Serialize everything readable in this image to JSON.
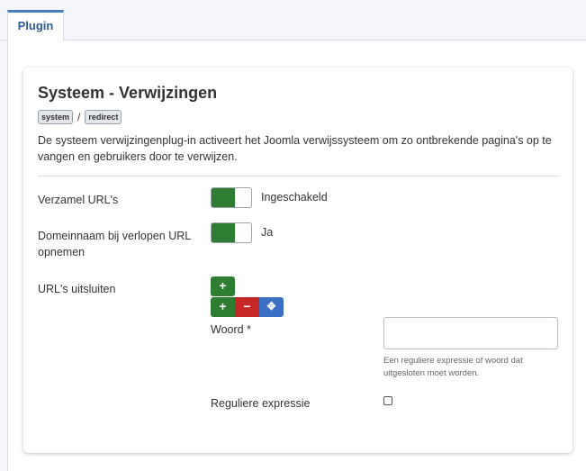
{
  "tabs": [
    {
      "label": "Plugin"
    }
  ],
  "plugin": {
    "title": "Systeem - Verwijzingen",
    "badges": [
      "system",
      "redirect"
    ],
    "badge_separator": "/",
    "description": "De systeem verwijzingenplug-in activeert het Joomla verwijssysteem om zo ontbrekende pagina's op te vangen en gebruikers door te verwijzen."
  },
  "fields": {
    "collect_urls": {
      "label": "Verzamel URL's",
      "state": "Ingeschakeld",
      "on": true
    },
    "domain_name": {
      "label": "Domeinnaam bij verlopen URL opnemen",
      "state": "Ja",
      "on": true
    },
    "exclude_urls": {
      "label": "URL's uitsluiten",
      "buttons": {
        "add": "+",
        "remove": "−",
        "move": "✥"
      },
      "word": {
        "label": "Woord *",
        "value": "",
        "hint": "Een reguliere expressie of woord dat uitgesloten moet worden."
      },
      "regex": {
        "label": "Reguliere expressie",
        "checked": false
      }
    }
  },
  "colors": {
    "accent": "#4a7dbf",
    "green": "#2e7d32",
    "red": "#c62828",
    "blue": "#3a6fc4"
  }
}
